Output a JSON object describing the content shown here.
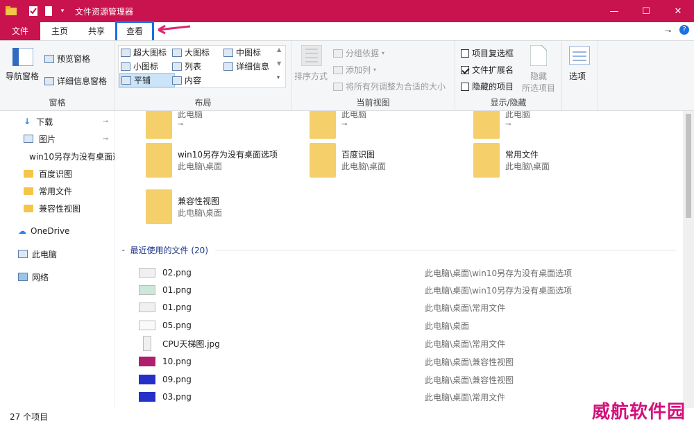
{
  "window": {
    "title": "文件资源管理器",
    "minimize": "—",
    "maximize": "☐",
    "close": "✕"
  },
  "tabs": [
    "文件",
    "主页",
    "共享",
    "查看"
  ],
  "ribbon": {
    "pane": {
      "nav_pane": "导航窗格",
      "preview": "预览窗格",
      "details": "详细信息窗格",
      "label": "窗格"
    },
    "layout": {
      "items": [
        "超大图标",
        "大图标",
        "中图标",
        "小图标",
        "列表",
        "详细信息",
        "平铺",
        "内容"
      ],
      "selected": "平铺",
      "label": "布局"
    },
    "current_view": {
      "sort": "排序方式",
      "group_by": "分组依据",
      "add_column": "添加列",
      "fit_columns": "将所有列调整为合适的大小",
      "label": "当前视图"
    },
    "show_hide": {
      "item_checkboxes": "项目复选框",
      "file_extensions": "文件扩展名",
      "hidden_items": "隐藏的项目",
      "hide_selected_1": "隐藏",
      "hide_selected_2": "所选项目",
      "label": "显示/隐藏"
    },
    "options": {
      "label": "选项"
    }
  },
  "nav": [
    "下载",
    "图片",
    "win10另存为没有桌面选项",
    "百度识图",
    "常用文件",
    "兼容性视图",
    "OneDrive",
    "此电脑",
    "网络"
  ],
  "tiles_top": [
    {
      "path": "此电脑"
    },
    {
      "path": "此电脑"
    },
    {
      "path": "此电脑"
    }
  ],
  "tiles": [
    {
      "name": "win10另存为没有桌面选项",
      "path": "此电脑\\桌面"
    },
    {
      "name": "百度识图",
      "path": "此电脑\\桌面"
    },
    {
      "name": "常用文件",
      "path": "此电脑\\桌面"
    },
    {
      "name": "兼容性视图",
      "path": "此电脑\\桌面"
    }
  ],
  "recent": {
    "header": "最近使用的文件 (20)",
    "files": [
      {
        "name": "02.png",
        "path": "此电脑\\桌面\\win10另存为没有桌面选项"
      },
      {
        "name": "01.png",
        "path": "此电脑\\桌面\\win10另存为没有桌面选项"
      },
      {
        "name": "01.png",
        "path": "此电脑\\桌面\\常用文件"
      },
      {
        "name": "05.png",
        "path": "此电脑\\桌面"
      },
      {
        "name": "CPU天梯图.jpg",
        "path": "此电脑\\桌面\\常用文件"
      },
      {
        "name": "10.png",
        "path": "此电脑\\桌面\\兼容性视图"
      },
      {
        "name": "09.png",
        "path": "此电脑\\桌面\\兼容性视图"
      },
      {
        "name": "03.png",
        "path": "此电脑\\桌面\\常用文件"
      }
    ]
  },
  "status": {
    "count": "27 个项目"
  },
  "watermark": "威航软件园"
}
